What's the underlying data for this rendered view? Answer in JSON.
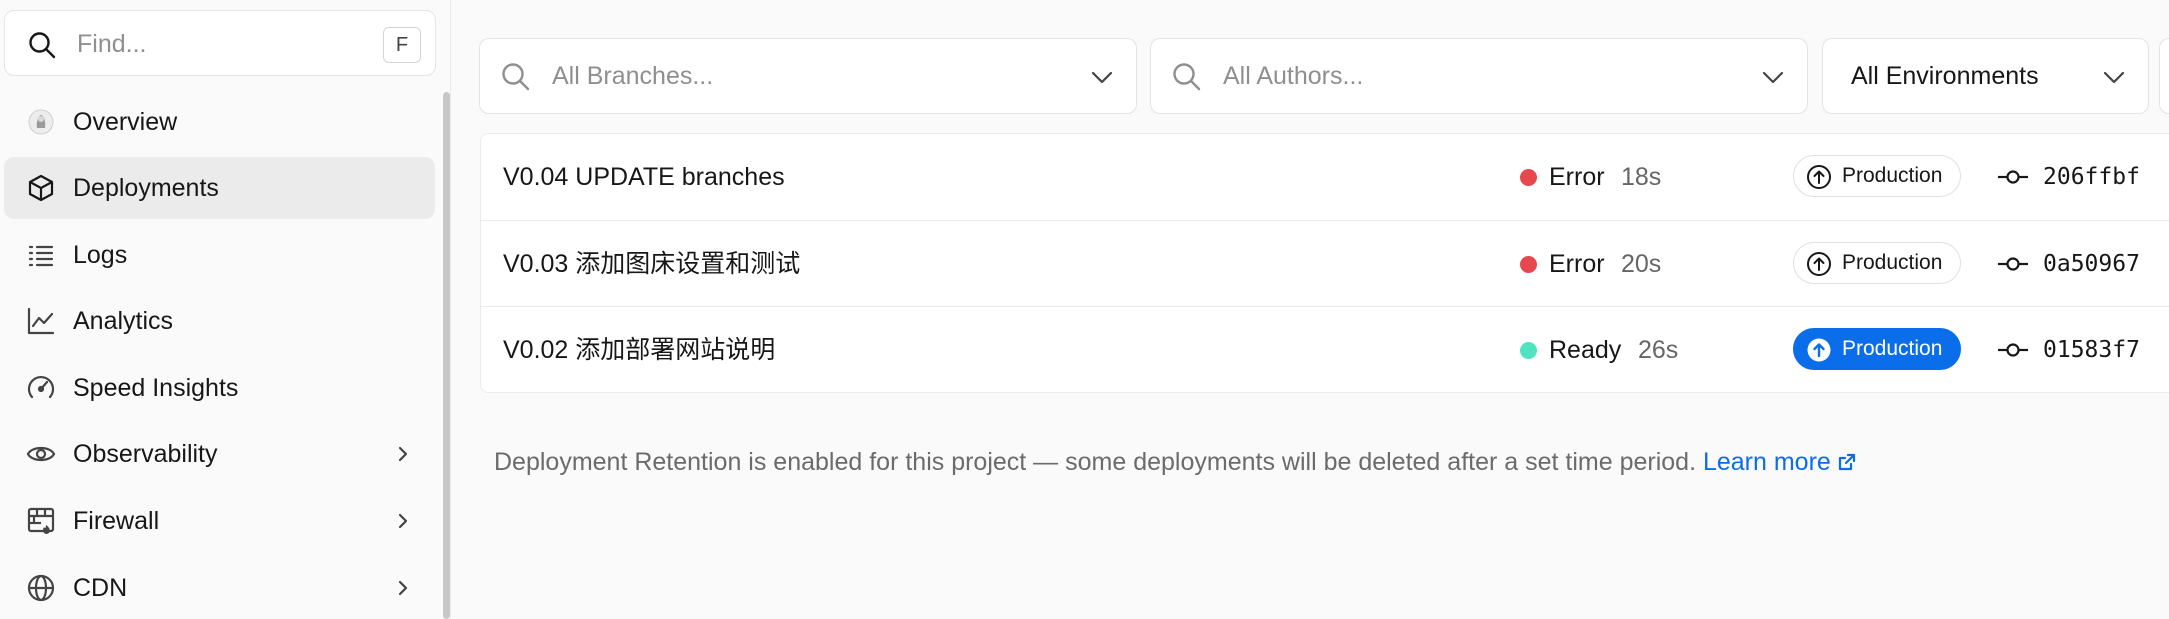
{
  "sidebar": {
    "find_placeholder": "Find...",
    "find_shortcut": "F",
    "items": [
      {
        "label": "Overview",
        "icon": "project-avatar-icon",
        "active": false,
        "has_chevron": false
      },
      {
        "label": "Deployments",
        "icon": "cube-icon",
        "active": true,
        "has_chevron": false
      },
      {
        "label": "Logs",
        "icon": "list-icon",
        "active": false,
        "has_chevron": false
      },
      {
        "label": "Analytics",
        "icon": "line-chart-icon",
        "active": false,
        "has_chevron": false
      },
      {
        "label": "Speed Insights",
        "icon": "gauge-icon",
        "active": false,
        "has_chevron": false
      },
      {
        "label": "Observability",
        "icon": "eye-icon",
        "active": false,
        "has_chevron": true
      },
      {
        "label": "Firewall",
        "icon": "firewall-icon",
        "active": false,
        "has_chevron": true
      },
      {
        "label": "CDN",
        "icon": "globe-icon",
        "active": false,
        "has_chevron": true
      }
    ]
  },
  "filters": {
    "branches_placeholder": "All Branches...",
    "authors_placeholder": "All Authors...",
    "environment_value": "All Environments"
  },
  "deployments": [
    {
      "message": "V0.04 UPDATE branches",
      "status": "Error",
      "status_color": "#e5484d",
      "duration": "18s",
      "environment": "Production",
      "current": false,
      "commit": "206ffbf"
    },
    {
      "message": "V0.03 添加图床设置和测试",
      "status": "Error",
      "status_color": "#e5484d",
      "duration": "20s",
      "environment": "Production",
      "current": false,
      "commit": "0a50967"
    },
    {
      "message": "V0.02 添加部署网站说明",
      "status": "Ready",
      "status_color": "#50e3c2",
      "duration": "26s",
      "environment": "Production",
      "current": true,
      "commit": "01583f7"
    }
  ],
  "retention": {
    "text": "Deployment Retention is enabled for this project — some deployments will be deleted after a set time period.",
    "link_label": "Learn more"
  },
  "colors": {
    "accent": "#0a6dea",
    "error": "#e5484d",
    "ready": "#50e3c2"
  }
}
